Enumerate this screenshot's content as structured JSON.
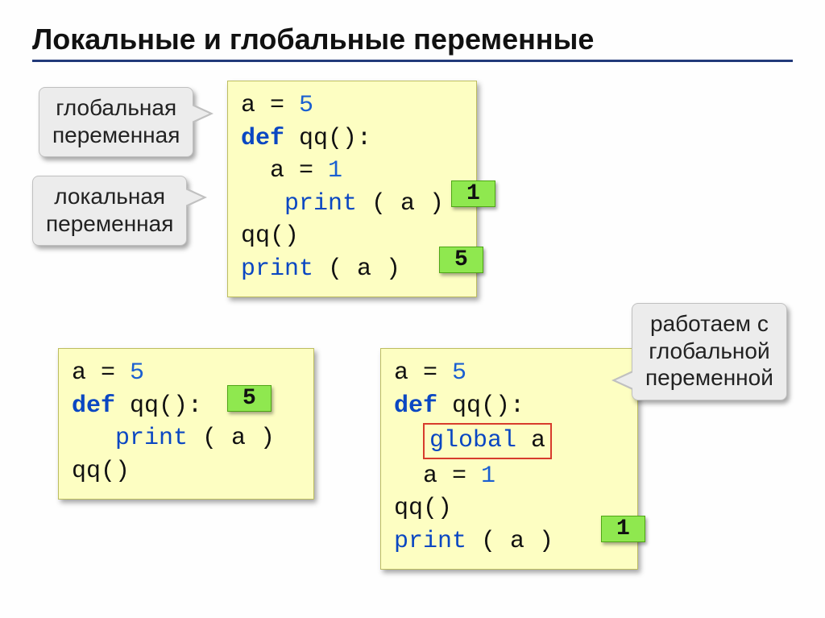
{
  "title": "Локальные и глобальные переменные",
  "callouts": {
    "global_var": {
      "l1": "глобальная",
      "l2": "переменная"
    },
    "local_var": {
      "l1": "локальная",
      "l2": "переменная"
    },
    "work_global": {
      "l1": "работаем с",
      "l2": "глобальной",
      "l3": "переменной"
    }
  },
  "code1": {
    "l1a": "a",
    "l1b": " = ",
    "l1c": "5",
    "l2a": "def",
    "l2b": " qq():",
    "l3a": "  a",
    "l3b": " = ",
    "l3c": "1",
    "l4a": "   ",
    "l4b": "print",
    "l4c": " ( a )",
    "l5": "qq()",
    "l6a": "print",
    "l6b": " ( a )",
    "out1": "1",
    "out2": "5"
  },
  "code2": {
    "l1a": "a",
    "l1b": " = ",
    "l1c": "5",
    "l2a": "def",
    "l2b": " qq():",
    "l3a": "   ",
    "l3b": "print",
    "l3c": " ( a )",
    "l4": "qq()",
    "out": "5"
  },
  "code3": {
    "l1a": "a",
    "l1b": " = ",
    "l1c": "5",
    "l2a": "def",
    "l2b": " qq():",
    "l3a": "global",
    "l3b": " a",
    "l4a": "  a",
    "l4b": " = ",
    "l4c": "1",
    "l5": "qq()",
    "l6a": "print",
    "l6b": " ( a )",
    "out": "1"
  }
}
